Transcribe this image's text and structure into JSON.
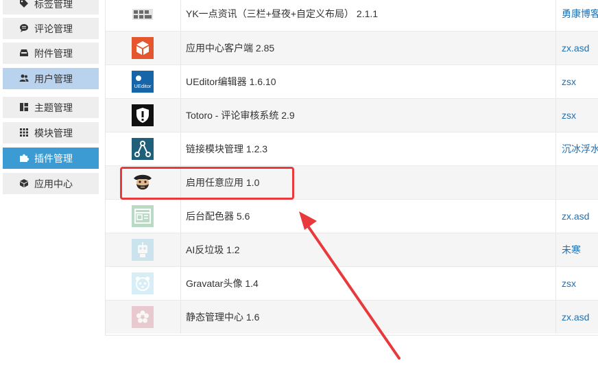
{
  "sidebar": {
    "items": [
      {
        "label": "标签管理",
        "icon": "tag-icon",
        "state": "normal"
      },
      {
        "label": "评论管理",
        "icon": "comment-icon",
        "state": "normal"
      },
      {
        "label": "附件管理",
        "icon": "inbox-icon",
        "state": "normal"
      },
      {
        "label": "用户管理",
        "icon": "users-icon",
        "state": "selected-light"
      },
      {
        "label": "主题管理",
        "icon": "layout-icon",
        "state": "normal"
      },
      {
        "label": "模块管理",
        "icon": "grid-icon",
        "state": "normal"
      },
      {
        "label": "插件管理",
        "icon": "puzzle-icon",
        "state": "active"
      },
      {
        "label": "应用中心",
        "icon": "cube-icon",
        "state": "normal"
      }
    ]
  },
  "plugins": [
    {
      "name": "YK一点资讯（三栏+昼夜+自定义布局） 2.1.1",
      "author": "勇康博客",
      "icon": "thumbnail-grid-icon"
    },
    {
      "name": "应用中心客户端 2.85",
      "author": "zx.asd",
      "icon": "orange-box-icon"
    },
    {
      "name": "UEditor编辑器 1.6.10",
      "author": "zsx",
      "icon": "ueditor-logo-icon",
      "icon_text": "UEditor"
    },
    {
      "name": "Totoro - 评论审核系统 2.9",
      "author": "zsx",
      "icon": "shield-alert-icon"
    },
    {
      "name": "链接模块管理 1.2.3",
      "author": "沉冰浮水",
      "icon": "share-nodes-icon"
    },
    {
      "name": "启用任意应用 1.0",
      "author": "",
      "icon": "pirate-face-icon"
    },
    {
      "name": "后台配色器 5.6",
      "author": "zx.asd",
      "icon": "window-layout-icon"
    },
    {
      "name": "AI反垃圾 1.2",
      "author": "未寒",
      "icon": "robot-icon"
    },
    {
      "name": "Gravatar头像 1.4",
      "author": "zsx",
      "icon": "panda-icon"
    },
    {
      "name": "静态管理中心 1.6",
      "author": "zx.asd",
      "icon": "flower-icon"
    }
  ],
  "colors": {
    "active": "#3d9bd4",
    "selected_light": "#b9d3ee",
    "link": "#1f6fb2",
    "highlight": "#e8393d"
  }
}
